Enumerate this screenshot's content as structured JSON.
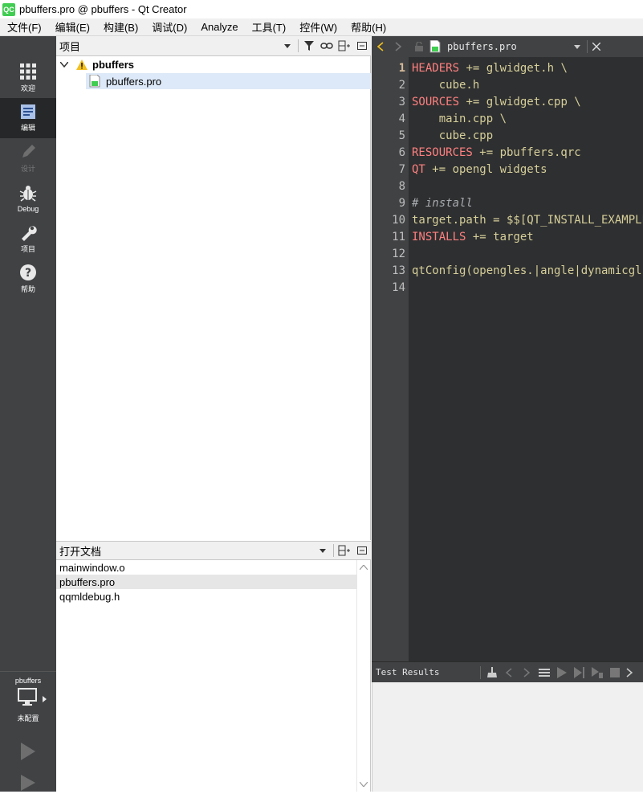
{
  "window": {
    "title": "pbuffers.pro @ pbuffers - Qt Creator",
    "app_icon_text": "QC"
  },
  "menu": [
    "文件(F)",
    "编辑(E)",
    "构建(B)",
    "调试(D)",
    "Analyze",
    "工具(T)",
    "控件(W)",
    "帮助(H)"
  ],
  "modes": {
    "welcome": "欢迎",
    "edit": "编辑",
    "design": "设计",
    "debug": "Debug",
    "projects": "项目",
    "help": "帮助"
  },
  "kit": {
    "project": "pbuffers",
    "status": "未配置"
  },
  "projects_pane": {
    "title": "项目",
    "root": "pbuffers",
    "child": "pbuffers.pro"
  },
  "open_documents": {
    "title": "打开文档",
    "items": [
      "mainwindow.o",
      "pbuffers.pro",
      "qqmldebug.h"
    ],
    "selected_index": 1
  },
  "editor": {
    "file_name": "pbuffers.pro",
    "current_line": 1,
    "line_numbers": [
      "1",
      "2",
      "3",
      "4",
      "5",
      "6",
      "7",
      "8",
      "9",
      "10",
      "11",
      "12",
      "13",
      "14"
    ],
    "lines": [
      {
        "k": "HEADERS",
        "r": " += glwidget.h \\"
      },
      {
        "k": "",
        "r": "    cube.h"
      },
      {
        "k": "SOURCES",
        "r": " += glwidget.cpp \\"
      },
      {
        "k": "",
        "r": "    main.cpp \\"
      },
      {
        "k": "",
        "r": "    cube.cpp"
      },
      {
        "k": "RESOURCES",
        "r": " += pbuffers.qrc"
      },
      {
        "k": "QT",
        "r": " += opengl widgets"
      },
      {
        "k": "",
        "r": ""
      },
      {
        "c": "# install"
      },
      {
        "k": "",
        "r": "target.path = $$[QT_INSTALL_EXAMPLES]"
      },
      {
        "k": "INSTALLS",
        "r": " += target"
      },
      {
        "k": "",
        "r": ""
      },
      {
        "k": "",
        "r": "qtConfig(opengles.|angle|dynamicgl)"
      },
      {
        "k": "",
        "r": ""
      }
    ]
  },
  "test_results": {
    "title": "Test Results"
  },
  "colors": {
    "sidebar": "#404244",
    "editor_bg": "#2e2f30",
    "keyword": "#ff8080",
    "text": "#d6cf9a",
    "selection": "#dde9f8"
  }
}
